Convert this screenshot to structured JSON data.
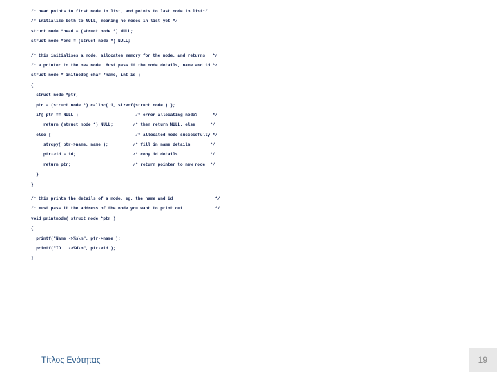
{
  "code": {
    "l1": "/* head points to first node in list, and points to last node in list*/",
    "l2": "/* initialize both to NULL, meaning no nodes in list yet */",
    "l3": "struct node *head = (struct node *) NULL;",
    "l4": "struct node *end = (struct node *) NULL;",
    "l5": "/* this initialises a node, allocates memory for the node, and returns   */",
    "l6": "/* a pointer to the new node. Must pass it the node details, name and id */",
    "l7": "struct node * initnode( char *name, int id )",
    "l8": "{",
    "l9": "  struct node *ptr;",
    "l10": "  ptr = (struct node *) calloc( 1, sizeof(struct node ) );",
    "l11": "  if( ptr == NULL )                       /* error allocating node?      */",
    "l12": "     return (struct node *) NULL;        /* then return NULL, else      */",
    "l13": "  else {                                  /* allocated node successfully */",
    "l14": "     strcpy( ptr->name, name );          /* fill in name details        */",
    "l15": "     ptr->id = id;                       /* copy id details             */",
    "l16": "     return ptr;                         /* return pointer to new node  */",
    "l17": "  }",
    "l18": "}",
    "l19": "/* this prints the details of a node, eg, the name and id                 */",
    "l20": "/* must pass it the address of the node you want to print out             */",
    "l21": "void printnode( struct node *ptr )",
    "l22": "{",
    "l23": "  printf(\"Name ->%s\\n\", ptr->name );",
    "l24": "  printf(\"ID   ->%d\\n\", ptr->id );",
    "l25": "}"
  },
  "footer": {
    "title": "Τίτλος Ενότητας",
    "page": "19"
  }
}
